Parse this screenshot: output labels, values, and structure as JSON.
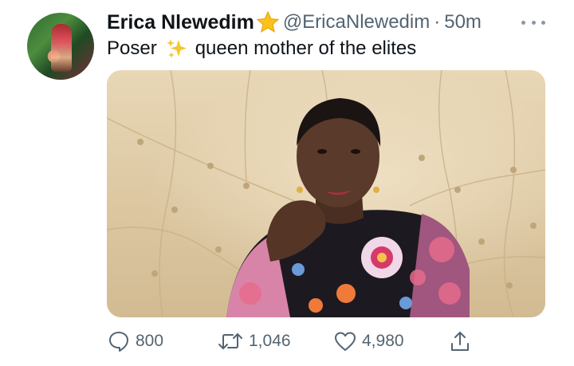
{
  "tweet": {
    "author": {
      "display_name": "Erica Nlewedim",
      "verified_emoji": "star",
      "handle": "@EricaNlewedim",
      "separator": "·",
      "time": "50m"
    },
    "text": {
      "before": "Poser",
      "emoji": "sparkles",
      "after": "queen mother of the elites"
    },
    "media": {
      "subject": "woman in floral dress seated before a cream tufted headboard",
      "colors": {
        "headboard": "#dcc7a1",
        "dress": "#e0a7c0",
        "skin": "#5a3a2a"
      }
    },
    "actions": {
      "reply_count": "800",
      "retweet_count": "1,046",
      "like_count": "4,980"
    },
    "colors": {
      "text": "#0f1419",
      "secondary": "#536471"
    }
  }
}
